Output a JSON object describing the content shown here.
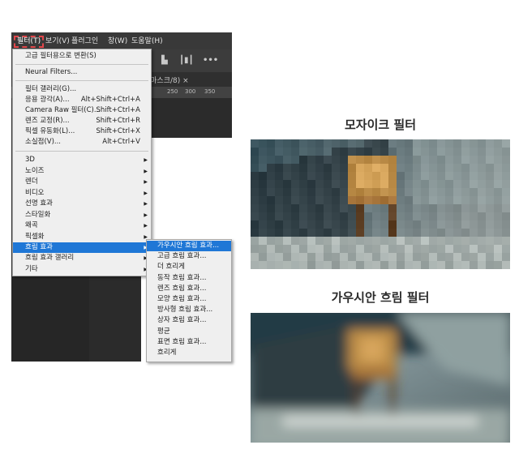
{
  "menubar": {
    "filter": "필터(T)",
    "view": "보기(V)",
    "plugins": "플러그인",
    "window": "창(W)",
    "help": "도움말(H)"
  },
  "tab": {
    "label": "어 마스크/8) ×"
  },
  "ruler": {
    "ticks": [
      "250",
      "300",
      "350"
    ]
  },
  "filter_menu": {
    "items": [
      {
        "label": "고급 필터용으로 변환(S)"
      },
      {
        "label": "Neural Filters..."
      },
      {
        "label": "필터 갤러리(G)..."
      },
      {
        "label": "응용 광각(A)...",
        "shortcut": "Alt+Shift+Ctrl+A"
      },
      {
        "label": "Camera Raw 필터(C)...",
        "shortcut": "Shift+Ctrl+A"
      },
      {
        "label": "렌즈 교정(R)...",
        "shortcut": "Shift+Ctrl+R"
      },
      {
        "label": "픽셀 유동화(L)...",
        "shortcut": "Shift+Ctrl+X"
      },
      {
        "label": "소실점(V)...",
        "shortcut": "Alt+Ctrl+V"
      },
      {
        "label": "3D"
      },
      {
        "label": "노이즈"
      },
      {
        "label": "렌더"
      },
      {
        "label": "비디오"
      },
      {
        "label": "선명 효과"
      },
      {
        "label": "스타일화"
      },
      {
        "label": "왜곡"
      },
      {
        "label": "픽셀화"
      },
      {
        "label": "흐림 효과"
      },
      {
        "label": "흐림 효과 갤러리"
      },
      {
        "label": "기타"
      }
    ]
  },
  "blur_submenu": {
    "items": [
      "가우시안 흐림 효과...",
      "고급 흐림 효과...",
      "더 흐리게",
      "동작 흐림 효과...",
      "렌즈 흐림 효과...",
      "모양 흐림 효과...",
      "방사형 흐림 효과...",
      "상자 흐림 효과...",
      "평균",
      "표면 흐림 효과...",
      "흐리게"
    ]
  },
  "captions": {
    "mosaic": "모자이크 필터",
    "gaussian": "가우시안 흐림 필터"
  },
  "colors": {
    "highlight": "#1f77d6",
    "filter_outline": "#e2474b"
  }
}
